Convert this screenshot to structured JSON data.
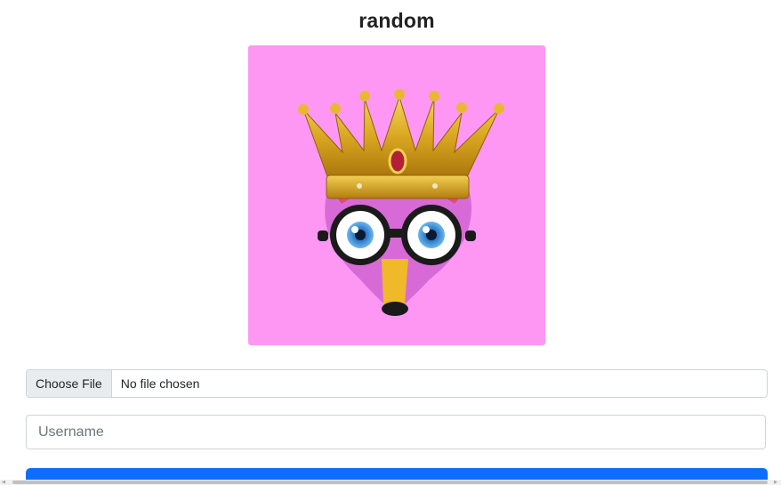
{
  "page": {
    "title": "random"
  },
  "avatar": {
    "background": "#fd97f3",
    "description_icon": "crowned-fox-avatar-icon"
  },
  "file_input": {
    "button_label": "Choose File",
    "status": "No file chosen"
  },
  "username": {
    "placeholder": "Username",
    "value": ""
  },
  "submit": {
    "label": "",
    "color": "#0d6efd"
  }
}
